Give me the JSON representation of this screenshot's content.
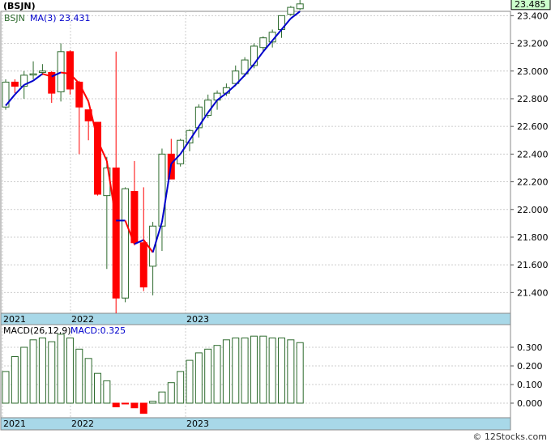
{
  "header": {
    "title": "(BSJN)",
    "ma_label": "MA(3)",
    "ma_value": "23.431",
    "ticker_short": "BSJN"
  },
  "price_panel": {
    "last_price_badge": "23.485",
    "y_tick_labels": [
      "23.400",
      "23.200",
      "23.000",
      "22.800",
      "22.600",
      "22.400",
      "22.200",
      "22.000",
      "21.800",
      "21.600",
      "21.400"
    ],
    "x_tick_labels": [
      "2021",
      "2022",
      "2023"
    ]
  },
  "macd_panel": {
    "label": "MACD(26,12,9)",
    "value_label": "MACD:0.325",
    "y_tick_labels": [
      "0.300",
      "0.200",
      "0.100",
      "0.000"
    ],
    "x_tick_labels": [
      "2021",
      "2022",
      "2023"
    ]
  },
  "footer": {
    "copyright": "© 12Stocks.com"
  },
  "colors": {
    "up_candle": "#2e6b2e",
    "down_candle": "#ff0000",
    "ma_rising": "#0000cc",
    "ma_falling": "#ff0000",
    "axis_band": "#a8d8e8",
    "badge_fill": "#ccffcc",
    "grid": "#cccccc"
  },
  "chart_data": [
    {
      "type": "candlestick",
      "title": "BSJN",
      "ylim": [
        21.25,
        23.6
      ],
      "grid": true,
      "candles": [
        {
          "o": 22.74,
          "h": 22.94,
          "l": 22.72,
          "c": 22.92
        },
        {
          "o": 22.92,
          "h": 22.94,
          "l": 22.84,
          "c": 22.89
        },
        {
          "o": 22.89,
          "h": 23.0,
          "l": 22.8,
          "c": 22.97
        },
        {
          "o": 22.98,
          "h": 23.07,
          "l": 22.94,
          "c": 22.98
        },
        {
          "o": 22.99,
          "h": 23.05,
          "l": 22.97,
          "c": 23.0
        },
        {
          "o": 22.99,
          "h": 23.0,
          "l": 22.77,
          "c": 22.84
        },
        {
          "o": 22.85,
          "h": 23.2,
          "l": 22.78,
          "c": 23.14
        },
        {
          "o": 23.14,
          "h": 23.15,
          "l": 22.83,
          "c": 22.87
        },
        {
          "o": 22.92,
          "h": 22.93,
          "l": 22.4,
          "c": 22.74
        },
        {
          "o": 22.72,
          "h": 22.72,
          "l": 22.5,
          "c": 22.64
        },
        {
          "o": 22.63,
          "h": 22.63,
          "l": 22.1,
          "c": 22.11
        },
        {
          "o": 22.1,
          "h": 22.38,
          "l": 21.57,
          "c": 22.3
        },
        {
          "o": 22.3,
          "h": 23.14,
          "l": 21.25,
          "c": 21.36
        },
        {
          "o": 21.36,
          "h": 22.16,
          "l": 21.33,
          "c": 22.15
        },
        {
          "o": 22.13,
          "h": 22.35,
          "l": 21.74,
          "c": 21.76
        },
        {
          "o": 21.76,
          "h": 22.16,
          "l": 21.41,
          "c": 21.44
        },
        {
          "o": 21.59,
          "h": 21.91,
          "l": 21.38,
          "c": 21.88
        },
        {
          "o": 21.88,
          "h": 22.44,
          "l": 21.7,
          "c": 22.4
        },
        {
          "o": 22.4,
          "h": 22.51,
          "l": 22.24,
          "c": 22.22
        },
        {
          "o": 22.33,
          "h": 22.51,
          "l": 22.31,
          "c": 22.5
        },
        {
          "o": 22.48,
          "h": 22.58,
          "l": 22.42,
          "c": 22.57
        },
        {
          "o": 22.59,
          "h": 22.76,
          "l": 22.52,
          "c": 22.74
        },
        {
          "o": 22.68,
          "h": 22.83,
          "l": 22.66,
          "c": 22.79
        },
        {
          "o": 22.79,
          "h": 22.86,
          "l": 22.72,
          "c": 22.84
        },
        {
          "o": 22.84,
          "h": 22.91,
          "l": 22.82,
          "c": 22.88
        },
        {
          "o": 22.91,
          "h": 23.04,
          "l": 22.89,
          "c": 23.0
        },
        {
          "o": 22.98,
          "h": 23.1,
          "l": 22.96,
          "c": 23.08
        },
        {
          "o": 23.04,
          "h": 23.2,
          "l": 23.02,
          "c": 23.18
        },
        {
          "o": 23.17,
          "h": 23.25,
          "l": 23.14,
          "c": 23.24
        },
        {
          "o": 23.21,
          "h": 23.3,
          "l": 23.17,
          "c": 23.28
        },
        {
          "o": 23.3,
          "h": 23.4,
          "l": 23.24,
          "c": 23.4
        },
        {
          "o": 23.41,
          "h": 23.47,
          "l": 23.4,
          "c": 23.46
        },
        {
          "o": 23.45,
          "h": 23.55,
          "l": 23.44,
          "c": 23.485
        }
      ],
      "ma3": [
        22.75,
        22.83,
        22.9,
        22.93,
        22.98,
        22.96,
        22.99,
        22.98,
        22.91,
        22.78,
        22.5,
        22.35,
        21.92,
        21.92,
        21.75,
        21.78,
        21.69,
        21.91,
        22.33,
        22.4,
        22.5,
        22.6,
        22.7,
        22.79,
        22.84,
        22.9,
        22.97,
        23.05,
        23.14,
        23.22,
        23.3,
        23.38,
        23.431
      ]
    },
    {
      "type": "bar",
      "title": "MACD(26,12,9)",
      "ylim": [
        -0.07,
        0.37
      ],
      "grid": true,
      "values": [
        0.17,
        0.25,
        0.3,
        0.34,
        0.35,
        0.33,
        0.37,
        0.35,
        0.29,
        0.24,
        0.16,
        0.12,
        -0.02,
        -0.003,
        -0.025,
        -0.055,
        0.01,
        0.06,
        0.11,
        0.17,
        0.23,
        0.27,
        0.29,
        0.31,
        0.34,
        0.35,
        0.35,
        0.36,
        0.36,
        0.35,
        0.35,
        0.34,
        0.325
      ]
    }
  ]
}
